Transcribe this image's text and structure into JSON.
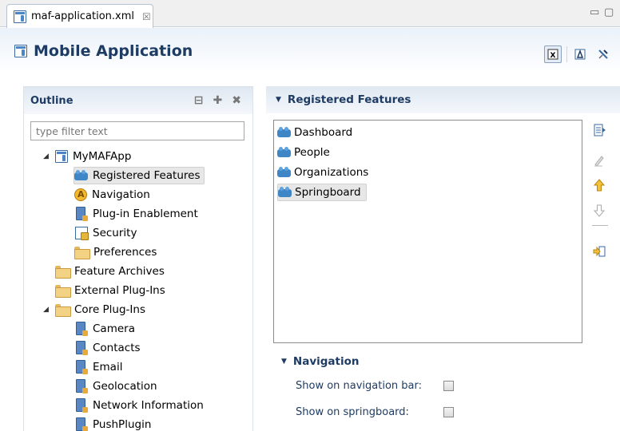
{
  "tab": {
    "label": "maf-application.xml",
    "close_glyph": "☒"
  },
  "window_controls": {
    "minimize": "▭",
    "maximize": "▢"
  },
  "editor": {
    "title": "Mobile Application",
    "toolbar": [
      "source-view-icon",
      "xml-validate-icon",
      "pin-icon"
    ]
  },
  "outline": {
    "title": "Outline",
    "filter_placeholder": "type filter text",
    "tools": {
      "collapse": "⊟",
      "add": "✚",
      "remove": "✖"
    },
    "tree": [
      {
        "label": "MyMAFApp",
        "icon": "app-icon",
        "expanded": true
      },
      {
        "label": "Registered Features",
        "icon": "feature-icon",
        "selected": true
      },
      {
        "label": "Navigation",
        "icon": "navigation-icon"
      },
      {
        "label": "Plug-in Enablement",
        "icon": "plugin-icon"
      },
      {
        "label": "Security",
        "icon": "security-icon"
      },
      {
        "label": "Preferences",
        "icon": "folder-icon"
      },
      {
        "label": "Feature Archives",
        "icon": "folder-icon"
      },
      {
        "label": "External Plug-Ins",
        "icon": "folder-icon"
      },
      {
        "label": "Core Plug-Ins",
        "icon": "folder-icon",
        "expanded": true
      },
      {
        "label": "Camera",
        "icon": "plugin-icon"
      },
      {
        "label": "Contacts",
        "icon": "plugin-icon"
      },
      {
        "label": "Email",
        "icon": "plugin-icon"
      },
      {
        "label": "Geolocation",
        "icon": "plugin-icon"
      },
      {
        "label": "Network Information",
        "icon": "plugin-icon"
      },
      {
        "label": "PushPlugin",
        "icon": "plugin-icon"
      }
    ]
  },
  "registered_features": {
    "title": "Registered Features",
    "items": [
      {
        "label": "Dashboard"
      },
      {
        "label": "People"
      },
      {
        "label": "Organizations"
      },
      {
        "label": "Springboard",
        "selected": true
      }
    ],
    "side_tools": [
      "add-feature-icon",
      "edit-icon",
      "move-up-icon",
      "move-down-icon",
      "insert-icon"
    ]
  },
  "navigation": {
    "title": "Navigation",
    "show_on_navigation_bar": {
      "label": "Show on navigation bar:",
      "checked": false
    },
    "show_on_springboard": {
      "label": "Show on springboard:",
      "checked": false
    }
  },
  "colors": {
    "header_text": "#1e3c63",
    "accent_blue": "#3f86c7",
    "up_arrow": "#f0b020"
  }
}
